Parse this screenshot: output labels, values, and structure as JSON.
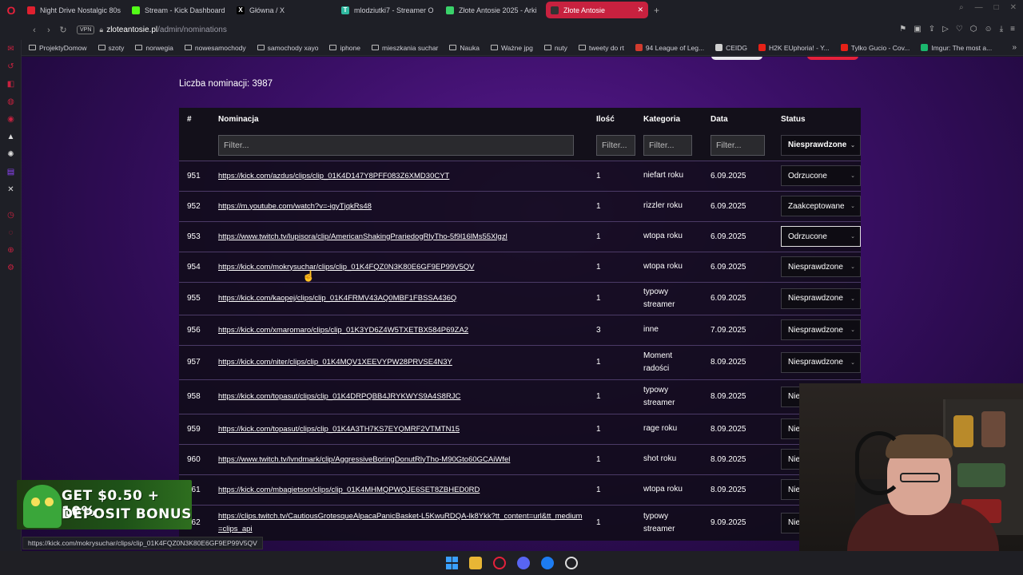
{
  "tabs": [
    {
      "title": "Night Drive Nostalgic 80s",
      "fav_color": "#e0202f"
    },
    {
      "title": "Stream - Kick Dashboard",
      "fav_color": "#53fc18"
    },
    {
      "title": "Główna / X",
      "fav_color": "#000000",
      "fav_glyph": "X"
    },
    {
      "title": "mlodziutki7 - Streamer O",
      "fav_color": "#2fb8a0",
      "fav_glyph": "T"
    },
    {
      "title": "Złote Antosie 2025 - Arki",
      "fav_color": "#3ad26a"
    },
    {
      "title": "Złote Antosie",
      "fav_color": "#333333",
      "active": true
    }
  ],
  "address": {
    "domain": "zloteantosie.pl",
    "path": "/admin/nominations",
    "vpn_label": "VPN"
  },
  "bookmarks": [
    {
      "label": "ProjektyDomow",
      "type": "folder"
    },
    {
      "label": "szoty",
      "type": "folder"
    },
    {
      "label": "norwegia",
      "type": "folder"
    },
    {
      "label": "nowesamochody",
      "type": "folder"
    },
    {
      "label": "samochody xayo",
      "type": "folder"
    },
    {
      "label": "iphone",
      "type": "folder"
    },
    {
      "label": "mieszkania suchar",
      "type": "folder"
    },
    {
      "label": "Nauka",
      "type": "folder"
    },
    {
      "label": "Ważne jpg",
      "type": "folder"
    },
    {
      "label": "nuty",
      "type": "folder"
    },
    {
      "label": "tweety do rt",
      "type": "folder"
    },
    {
      "label": "94 League of Leg...",
      "type": "site",
      "color": "#d13b2e"
    },
    {
      "label": "CEIDG",
      "type": "site",
      "color": "#cfcfcf"
    },
    {
      "label": "H2K EUphoria! - Y...",
      "type": "site",
      "color": "#e62117"
    },
    {
      "label": "Tylko Gucio - Cov...",
      "type": "site",
      "color": "#e62117"
    },
    {
      "label": "Imgur: The most a...",
      "type": "site",
      "color": "#1bb76e"
    }
  ],
  "page": {
    "count_label": "Liczba nominacji: 3987",
    "headers": {
      "num": "#",
      "nomination": "Nominacja",
      "qty": "Ilość",
      "category": "Kategoria",
      "date": "Data",
      "status": "Status"
    },
    "filters": {
      "nomination": "Filter...",
      "qty": "Filter...",
      "category": "Filter...",
      "date": "Filter...",
      "status": "Niesprawdzone"
    },
    "rows": [
      {
        "num": "951",
        "link": "https://kick.com/azdus/clips/clip_01K4D147Y8PFF083Z6XMD30CYT",
        "qty": "1",
        "cat": [
          "niefart roku"
        ],
        "date": "6.09.2025",
        "status": "Odrzucone"
      },
      {
        "num": "952",
        "link": "https://m.youtube.com/watch?v=-igyTjqkRs48",
        "qty": "1",
        "cat": [
          "rizzler roku"
        ],
        "date": "6.09.2025",
        "status": "Zaakceptowane"
      },
      {
        "num": "953",
        "link": "https://www.twitch.tv/lupisora/clip/AmericanShakingPrariedogRlyTho-5f9l16lMs55Xlgzl",
        "qty": "1",
        "cat": [
          "wtopa roku"
        ],
        "date": "6.09.2025",
        "status": "Odrzucone",
        "focus": true
      },
      {
        "num": "954",
        "link": "https://kick.com/mokrysuchar/clips/clip_01K4FQZ0N3K80E6GF9EP99V5QV",
        "qty": "1",
        "cat": [
          "wtopa roku"
        ],
        "date": "6.09.2025",
        "status": "Niesprawdzone"
      },
      {
        "num": "955",
        "link": "https://kick.com/kaopej/clips/clip_01K4FRMV43AQ0MBF1FBSSA436Q",
        "qty": "1",
        "cat": [
          "typowy",
          "streamer"
        ],
        "date": "6.09.2025",
        "status": "Niesprawdzone"
      },
      {
        "num": "956",
        "link": "https://kick.com/xmaromaro/clips/clip_01K3YD6Z4W5TXETBX584P69ZA2",
        "qty": "3",
        "cat": [
          "inne"
        ],
        "date": "7.09.2025",
        "status": "Niesprawdzone"
      },
      {
        "num": "957",
        "link": "https://kick.com/niter/clips/clip_01K4MQV1XEEVYPW28PRVSE4N3Y",
        "qty": "1",
        "cat": [
          "Moment",
          "radości"
        ],
        "date": "8.09.2025",
        "status": "Niesprawdzone"
      },
      {
        "num": "958",
        "link": "https://kick.com/topasut/clips/clip_01K4DRPQBB4JRYKWYS9A4S8RJC",
        "qty": "1",
        "cat": [
          "typowy",
          "streamer"
        ],
        "date": "8.09.2025",
        "status": "Niesp"
      },
      {
        "num": "959",
        "link": "https://kick.com/topasut/clips/clip_01K4A3TH7KS7EYQMRF2VTMTN15",
        "qty": "1",
        "cat": [
          "rage roku"
        ],
        "date": "8.09.2025",
        "status": "Niesp"
      },
      {
        "num": "960",
        "link": "https://www.twitch.tv/lvndmark/clip/AggressiveBoringDonutRlyTho-M90Gto60GCAiWfel",
        "qty": "1",
        "cat": [
          "shot roku"
        ],
        "date": "8.09.2025",
        "status": "Niesp"
      },
      {
        "num": "961",
        "link": "https://kick.com/mbagietson/clips/clip_01K4MHMQPWQJE6SET8ZBHED0RD",
        "qty": "1",
        "cat": [
          "wtopa roku"
        ],
        "date": "8.09.2025",
        "status": "Niesp"
      },
      {
        "num": "962",
        "link": "https://clips.twitch.tv/CautiousGrotesqueAlpacaPanicBasket-L5KwuRDQA-lk8Ykk?tt_content=url&tt_medium=clips_api",
        "qty": "1",
        "cat": [
          "typowy",
          "streamer"
        ],
        "date": "9.09.2025",
        "status": "Niesp"
      }
    ]
  },
  "status_bar_url": "https://kick.com/mokrysuchar/clips/clip_01K4FQZ0N3K80E6GF9EP99V5QV",
  "promo": {
    "line1": "GET $0.50 + 10%",
    "line2": "DEPOSIT BONUS"
  },
  "colors": {
    "accent": "#c8213f",
    "page_bg": "#3a0f66",
    "table_bg": "#100c18"
  }
}
